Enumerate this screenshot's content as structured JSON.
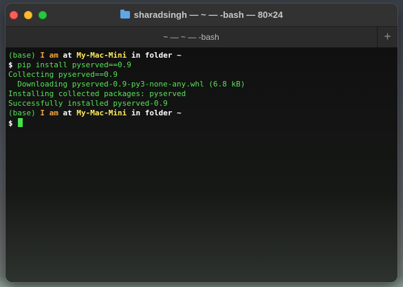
{
  "window": {
    "title": "sharadsingh — ~ — -bash — 80×24",
    "folder_icon": "folder-icon"
  },
  "tabs": [
    {
      "label": "~ — ~ — -bash"
    }
  ],
  "new_tab_symbol": "+",
  "prompt": {
    "env": "(base)",
    "i": "I",
    "am": "am",
    "at": "at",
    "host": "My-Mac-Mini",
    "in_folder": "in folder",
    "dir": "~",
    "symbol": "$"
  },
  "output": {
    "command": "pip install pyserved==0.9",
    "lines": [
      "Collecting pyserved==0.9",
      "  Downloading pyserved-0.9-py3-none-any.whl (6.8 kB)",
      "Installing collected packages: pyserved",
      "Successfully installed pyserved-0.9"
    ]
  },
  "colors": {
    "green": "#56e256",
    "orange": "#f5a33a",
    "yellow": "#ffea5c",
    "close": "#fe5f57",
    "minimize": "#febc2e",
    "maximize": "#28c840"
  }
}
